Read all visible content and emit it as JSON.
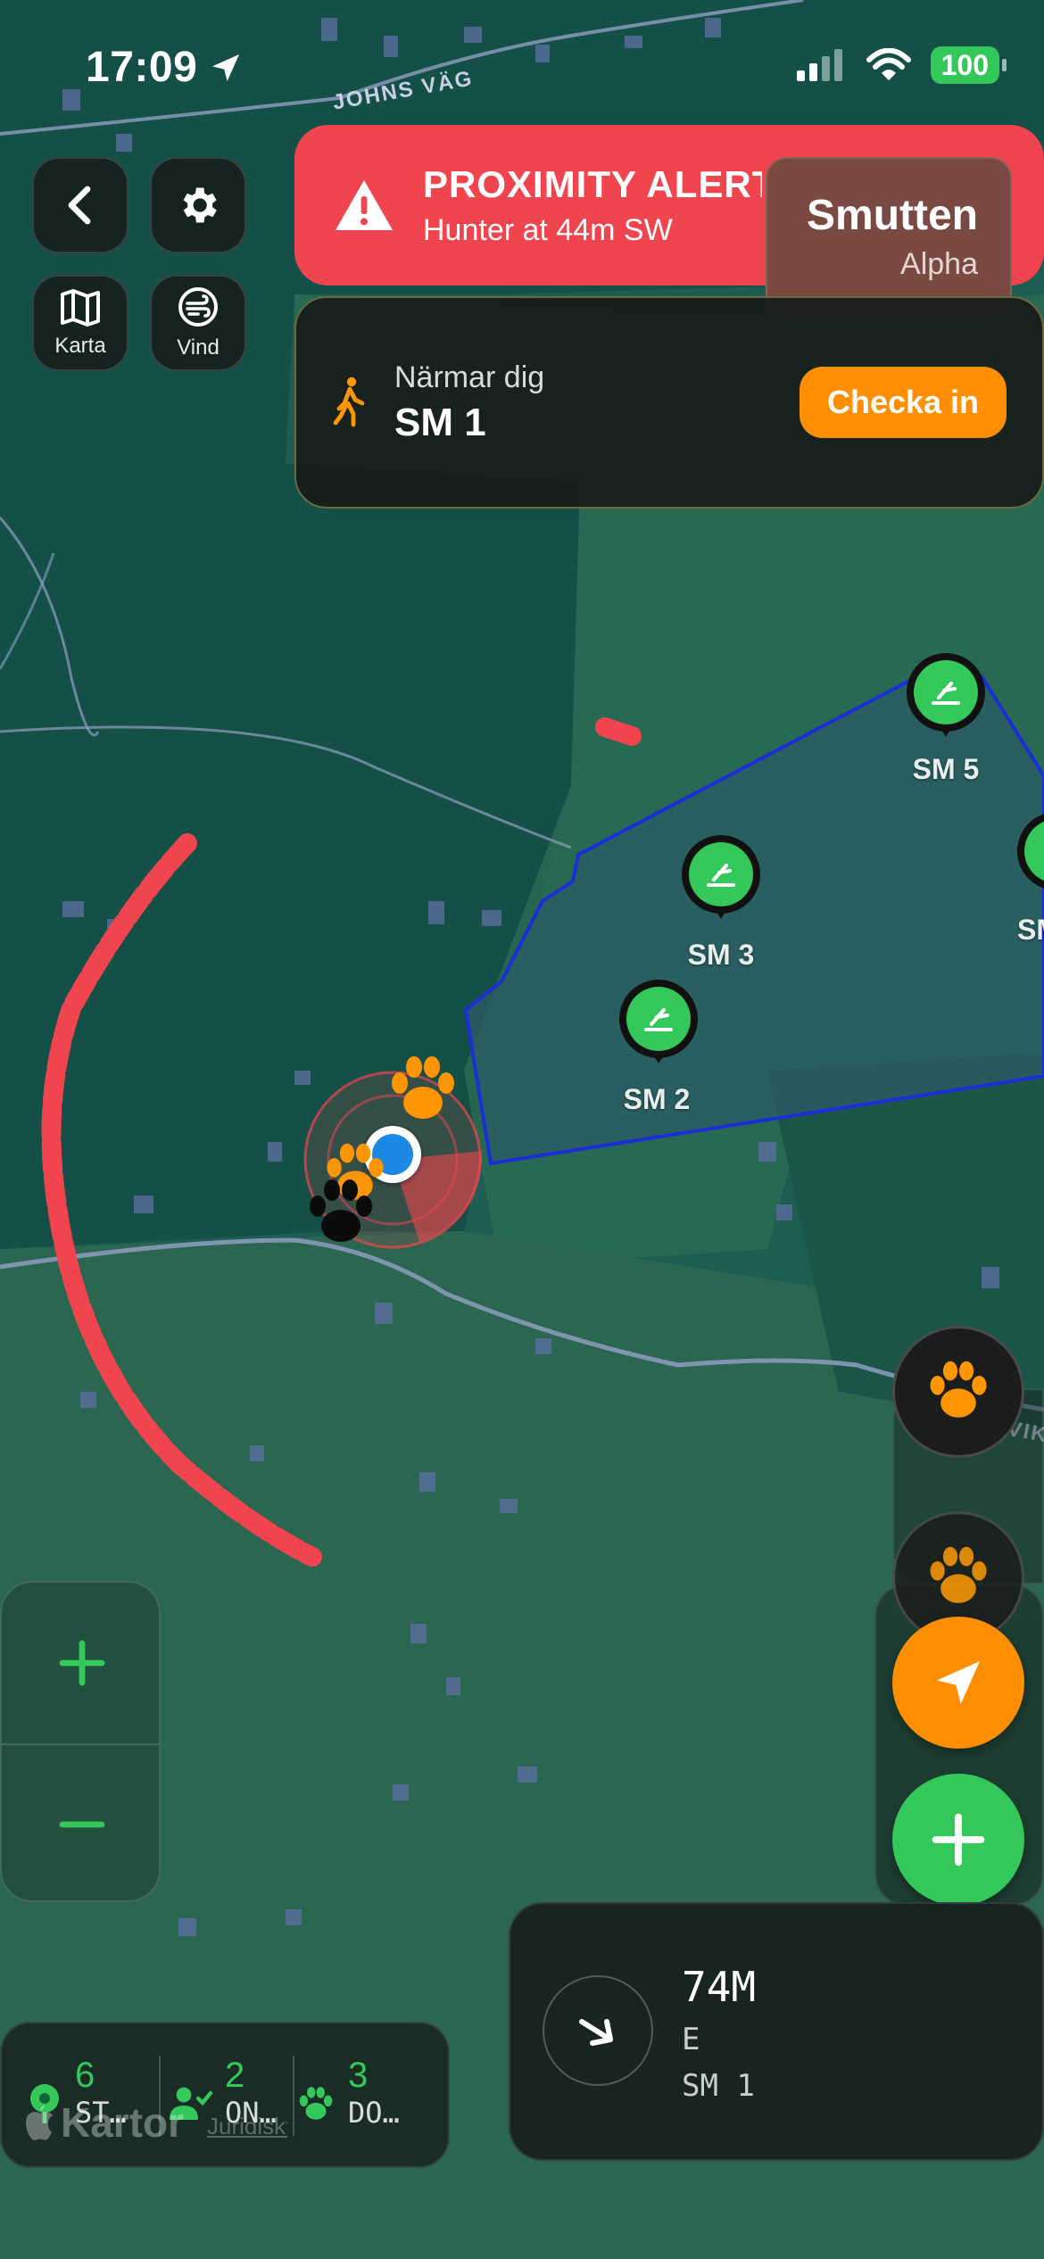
{
  "status_bar": {
    "time": "17:09",
    "battery": "100"
  },
  "map": {
    "road_label": "JOHNS VÄG",
    "road_label_2": "RVIK",
    "attribution": "Kartor",
    "legal": "Juridiskt"
  },
  "toolbar": {
    "map_label": "Karta",
    "wind_label": "Vind"
  },
  "alert": {
    "title": "PROXIMITY ALERT",
    "subtitle": "Hunter at 44m SW"
  },
  "hunter_card": {
    "name": "Smutten",
    "role": "Alpha"
  },
  "approach": {
    "status": "Närmar dig",
    "target": "SM 1",
    "checkin_label": "Checka in"
  },
  "stands": [
    {
      "label": "SM 5"
    },
    {
      "label": "SM 3"
    },
    {
      "label": "SM 2"
    },
    {
      "label": "SM"
    }
  ],
  "navigation": {
    "distance": "74M",
    "direction": "E",
    "target": "SM 1"
  },
  "stats": [
    {
      "count": "6",
      "label": "ST…"
    },
    {
      "count": "2",
      "label": "ON…"
    },
    {
      "count": "3",
      "label": "DO…"
    }
  ],
  "colors": {
    "alert": "#f0454e",
    "accent_orange": "#ff8f00",
    "accent_green": "#34c759",
    "zone_border": "#1a2fd6"
  }
}
